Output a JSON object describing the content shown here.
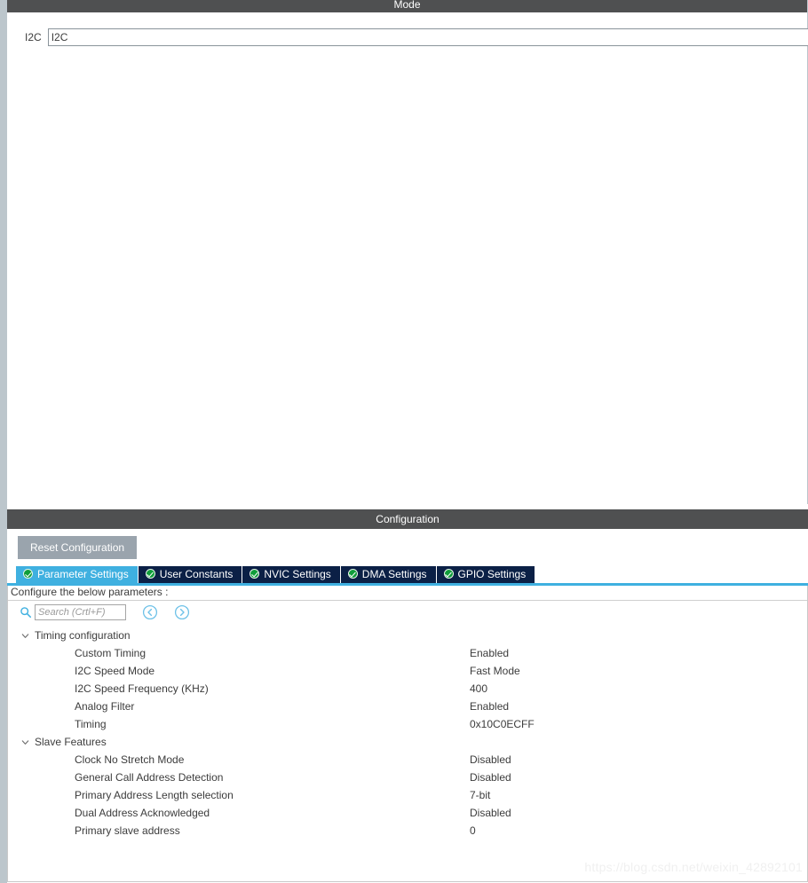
{
  "mode_panel": {
    "title": "Mode",
    "row": {
      "label": "I2C",
      "value": "I2C"
    }
  },
  "config_panel": {
    "title": "Configuration",
    "reset_label": "Reset Configuration",
    "tabs": [
      {
        "label": "Parameter Settings",
        "icon": "check-circle-icon",
        "active": true
      },
      {
        "label": "User Constants",
        "icon": "check-circle-icon",
        "active": false
      },
      {
        "label": "NVIC Settings",
        "icon": "check-circle-icon",
        "active": false
      },
      {
        "label": "DMA Settings",
        "icon": "check-circle-icon",
        "active": false
      },
      {
        "label": "GPIO Settings",
        "icon": "check-circle-icon",
        "active": false
      }
    ],
    "hint": "Configure the below parameters :",
    "search": {
      "placeholder": "Search (Crtl+F)",
      "value": "",
      "icon": "search-icon",
      "prev_icon": "previous-circle-icon",
      "next_icon": "next-circle-icon"
    },
    "groups": [
      {
        "label": "Timing configuration",
        "expanded": true,
        "params": [
          {
            "name": "Custom Timing",
            "value": "Enabled"
          },
          {
            "name": "I2C Speed Mode",
            "value": "Fast Mode"
          },
          {
            "name": "I2C Speed Frequency (KHz)",
            "value": "400"
          },
          {
            "name": "Analog Filter",
            "value": "Enabled"
          },
          {
            "name": "Timing",
            "value": "0x10C0ECFF"
          }
        ]
      },
      {
        "label": "Slave Features",
        "expanded": true,
        "params": [
          {
            "name": "Clock No Stretch Mode",
            "value": "Disabled"
          },
          {
            "name": "General Call Address Detection",
            "value": "Disabled"
          },
          {
            "name": "Primary Address Length selection",
            "value": "7-bit"
          },
          {
            "name": "Dual Address Acknowledged",
            "value": "Disabled"
          },
          {
            "name": "Primary slave address",
            "value": "0"
          }
        ]
      }
    ]
  },
  "watermark": "https://blog.csdn.net/weixin_42892101",
  "colors": {
    "panel_header": "#4f5051",
    "tab_active": "#3fb0e0",
    "tab_inactive": "#0b2046",
    "check_green": "#0f9d3a",
    "button_gray": "#9aa4ad",
    "left_strip": "#bcc6cc"
  }
}
